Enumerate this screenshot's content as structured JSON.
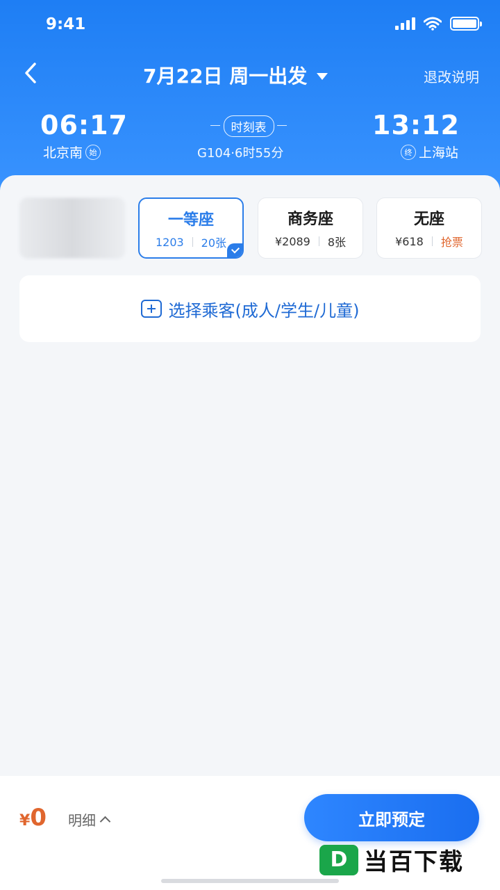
{
  "status_bar": {
    "time": "9:41"
  },
  "header": {
    "date_title": "7月22日 周一出发",
    "refund_label": "退改说明",
    "departure": {
      "time": "06:17",
      "station": "北京南",
      "badge": "始"
    },
    "arrival": {
      "time": "13:12",
      "station": "上海站",
      "badge": "终"
    },
    "timetable_label": "时刻表",
    "train_info": "G104·6时55分"
  },
  "seats": [
    {
      "name": "一等座",
      "price": "1203",
      "count": "20张",
      "selected": true
    },
    {
      "name": "商务座",
      "price": "¥2089",
      "count": "8张"
    },
    {
      "name": "无座",
      "price": "¥618",
      "action": "抢票"
    }
  ],
  "passenger": {
    "label": "选择乘客(成人/学生/儿童)"
  },
  "footer": {
    "currency": "¥",
    "amount": "0",
    "detail_label": "明细",
    "book_label": "立即预定",
    "watermark_logo": "D",
    "watermark_text": "当百下载"
  },
  "colors": {
    "primary": "#1e7ef4",
    "accent": "#e0662e",
    "selected": "#2b7de9"
  }
}
